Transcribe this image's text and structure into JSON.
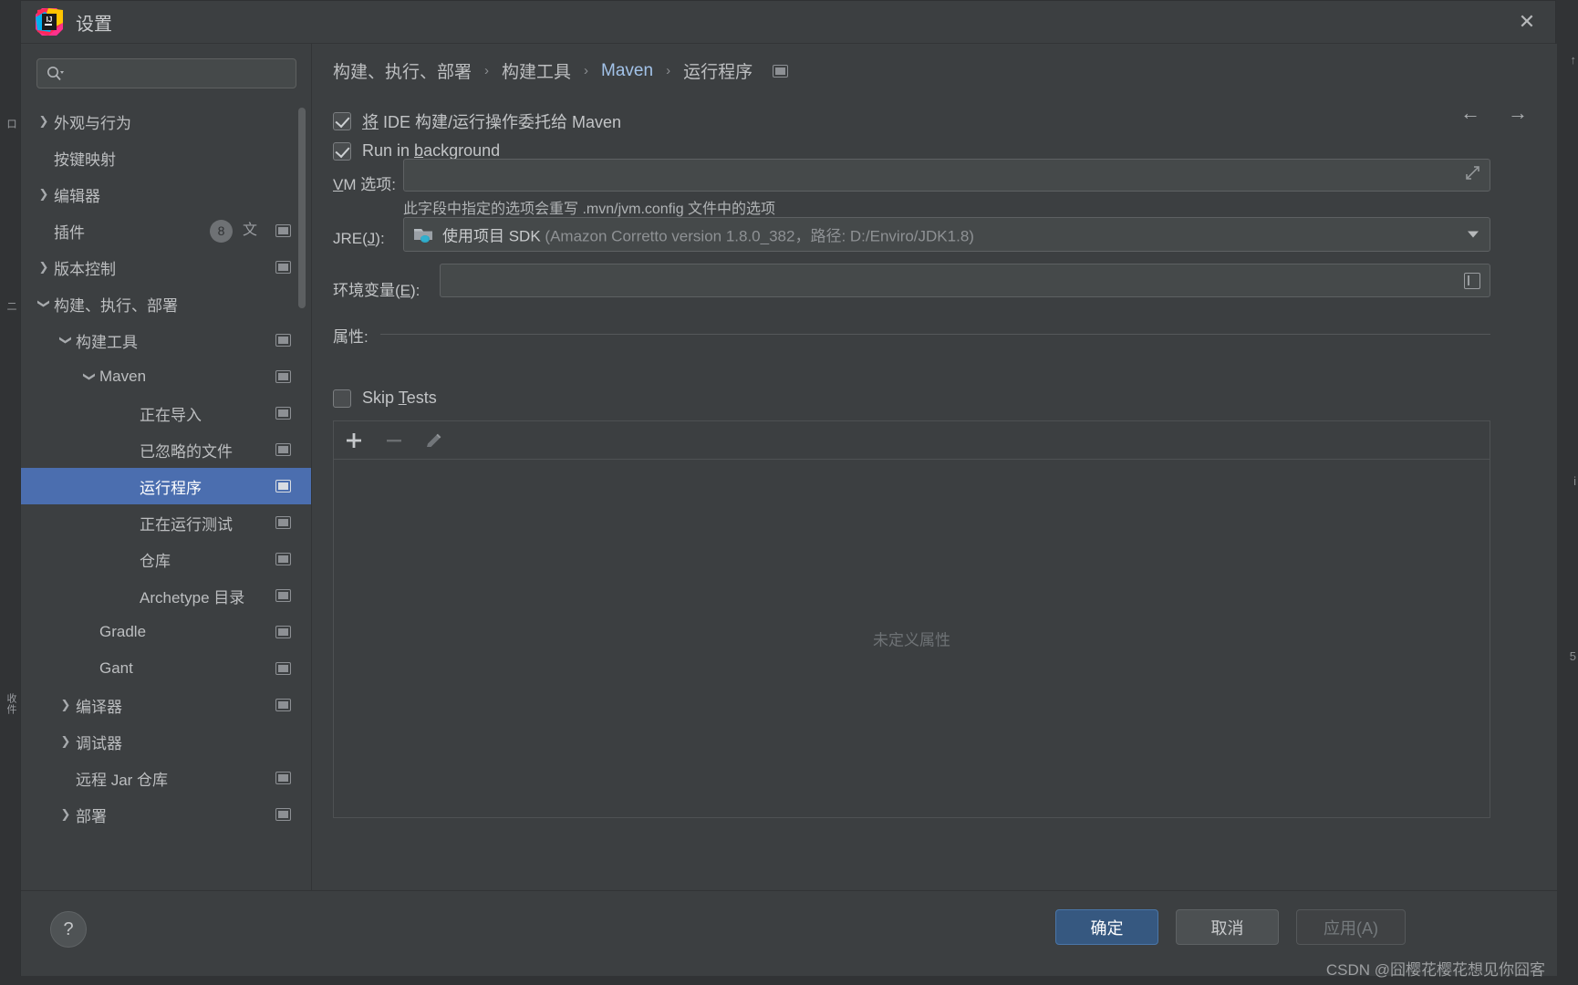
{
  "window": {
    "title": "设置",
    "logo_text": "IJ",
    "close_icon": "✕"
  },
  "search": {
    "value": "",
    "placeholder": ""
  },
  "sidebar": {
    "items": [
      {
        "label": "外观与行为",
        "indent": 0,
        "twisty": "collapsed",
        "monitor": false,
        "selected": false
      },
      {
        "label": "按键映射",
        "indent": 0,
        "twisty": "none",
        "monitor": false,
        "selected": false
      },
      {
        "label": "编辑器",
        "indent": 0,
        "twisty": "collapsed",
        "monitor": false,
        "selected": false
      },
      {
        "label": "插件",
        "indent": 0,
        "twisty": "none",
        "monitor": true,
        "selected": false,
        "badge": "8",
        "extra_icon": "translate-icon"
      },
      {
        "label": "版本控制",
        "indent": 0,
        "twisty": "collapsed",
        "monitor": true,
        "selected": false
      },
      {
        "label": "构建、执行、部署",
        "indent": 0,
        "twisty": "expanded",
        "monitor": false,
        "selected": false
      },
      {
        "label": "构建工具",
        "indent": 1,
        "twisty": "expanded",
        "monitor": true,
        "selected": false
      },
      {
        "label": "Maven",
        "indent": 2,
        "twisty": "expanded",
        "monitor": true,
        "selected": false
      },
      {
        "label": "正在导入",
        "indent": 3,
        "twisty": "none",
        "monitor": true,
        "selected": false
      },
      {
        "label": "已忽略的文件",
        "indent": 3,
        "twisty": "none",
        "monitor": true,
        "selected": false
      },
      {
        "label": "运行程序",
        "indent": 3,
        "twisty": "none",
        "monitor": true,
        "selected": true
      },
      {
        "label": "正在运行测试",
        "indent": 3,
        "twisty": "none",
        "monitor": true,
        "selected": false
      },
      {
        "label": "仓库",
        "indent": 3,
        "twisty": "none",
        "monitor": true,
        "selected": false
      },
      {
        "label": "Archetype 目录",
        "indent": 3,
        "twisty": "none",
        "monitor": true,
        "selected": false
      },
      {
        "label": "Gradle",
        "indent": 2,
        "twisty": "none",
        "monitor": true,
        "selected": false
      },
      {
        "label": "Gant",
        "indent": 2,
        "twisty": "none",
        "monitor": true,
        "selected": false
      },
      {
        "label": "编译器",
        "indent": 1,
        "twisty": "collapsed",
        "monitor": true,
        "selected": false
      },
      {
        "label": "调试器",
        "indent": 1,
        "twisty": "collapsed",
        "monitor": false,
        "selected": false
      },
      {
        "label": "远程 Jar 仓库",
        "indent": 1,
        "twisty": "none",
        "monitor": true,
        "selected": false
      },
      {
        "label": "部署",
        "indent": 1,
        "twisty": "collapsed",
        "monitor": true,
        "selected": false
      }
    ]
  },
  "breadcrumb": {
    "items": [
      "构建、执行、部署",
      "构建工具",
      "Maven",
      "运行程序"
    ],
    "separator": "›"
  },
  "main": {
    "delegate_checkbox": {
      "label_pre": "将 IDE 构建/运行操作委托给 Maven",
      "checked": true
    },
    "run_background_checkbox": {
      "label": "Run in background",
      "mnemonic": "b",
      "checked": true
    },
    "vm_options": {
      "label": "VM 选项:",
      "mnemonic": "V",
      "value": "",
      "hint": "此字段中指定的选项会重写 .mvn/jvm.config 文件中的选项",
      "expand_icon": "expand-diagonal-icon"
    },
    "jre": {
      "label": "JRE(J):",
      "mnemonic": "J",
      "value_strong": "使用项目 SDK",
      "value_dim": "(Amazon Corretto version 1.8.0_382，路径: D:/Enviro/JDK1.8)"
    },
    "env_vars": {
      "label": "环境变量(E):",
      "mnemonic": "E",
      "value": ""
    },
    "properties": {
      "section_label": "属性:",
      "skip_tests": {
        "label": "Skip Tests",
        "mnemonic": "T",
        "checked": false
      },
      "toolbar": [
        {
          "name": "add-button",
          "glyph": "+",
          "enabled": true
        },
        {
          "name": "remove-button",
          "glyph": "−",
          "enabled": false
        },
        {
          "name": "edit-button",
          "glyph": "✎",
          "enabled": false
        }
      ],
      "empty_text": "未定义属性"
    }
  },
  "footer": {
    "help_label": "?",
    "ok_label": "确定",
    "cancel_label": "取消",
    "apply_label": "应用(A)"
  },
  "watermark": {
    "text": "CSDN @囧樱花樱花想见你囧客"
  },
  "colors": {
    "background": "#3c3f41",
    "field": "#45494a",
    "selection": "#4b6eaf",
    "primary_button": "#365880",
    "accent_text": "#a2c2e8"
  }
}
